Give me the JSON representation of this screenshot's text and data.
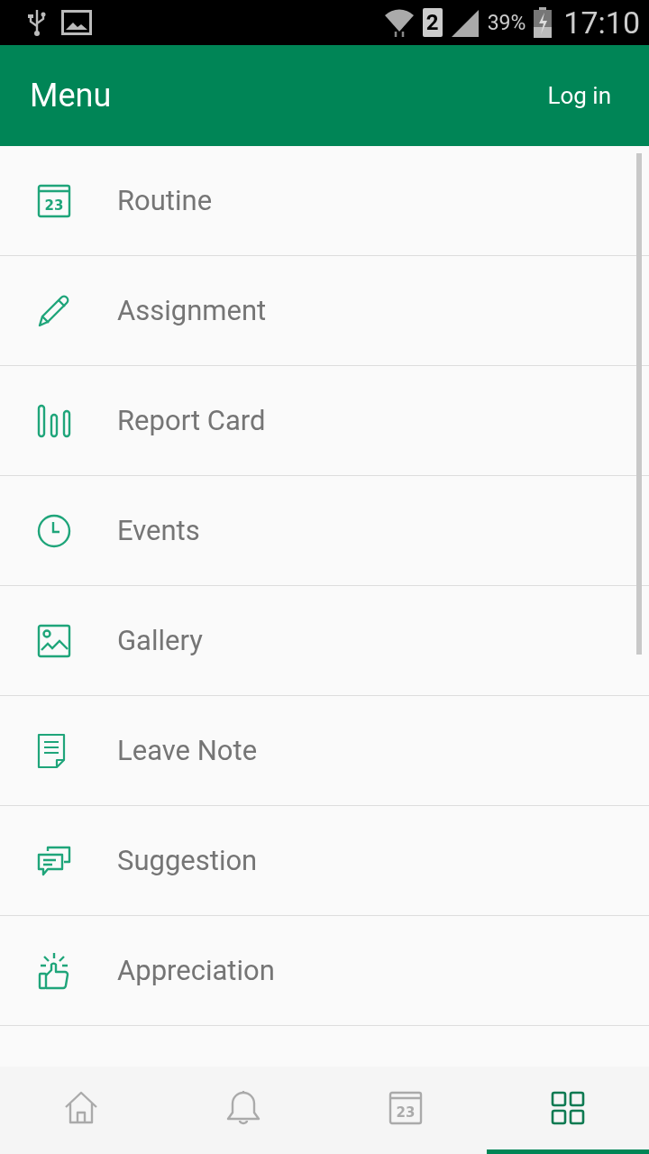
{
  "status_bar": {
    "sim_slot": "2",
    "battery_percent": "39%",
    "time": "17:10"
  },
  "header": {
    "title": "Menu",
    "action": "Log in"
  },
  "menu_items": [
    {
      "kind": "calendar",
      "label": "Routine",
      "icon_text": "23"
    },
    {
      "kind": "pencil",
      "label": "Assignment"
    },
    {
      "kind": "bars",
      "label": "Report Card"
    },
    {
      "kind": "clock",
      "label": "Events"
    },
    {
      "kind": "image",
      "label": "Gallery"
    },
    {
      "kind": "note",
      "label": "Leave Note"
    },
    {
      "kind": "chat",
      "label": "Suggestion"
    },
    {
      "kind": "thumbs",
      "label": "Appreciation"
    }
  ],
  "bottom_nav": [
    {
      "kind": "home",
      "selected": false
    },
    {
      "kind": "bell",
      "selected": false
    },
    {
      "kind": "calendar",
      "selected": false,
      "icon_text": "23"
    },
    {
      "kind": "grid",
      "selected": true
    }
  ]
}
